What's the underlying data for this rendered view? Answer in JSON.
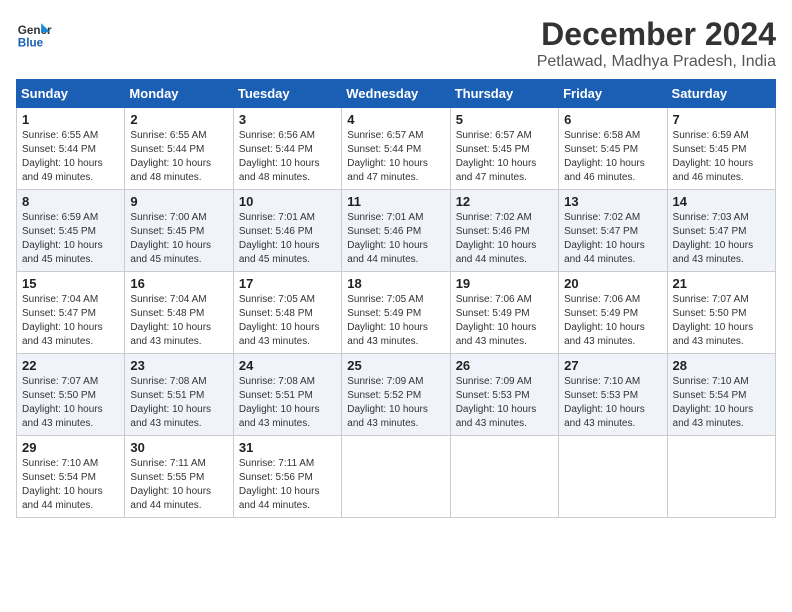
{
  "header": {
    "logo_line1": "General",
    "logo_line2": "Blue",
    "month_year": "December 2024",
    "location": "Petlawad, Madhya Pradesh, India"
  },
  "days_of_week": [
    "Sunday",
    "Monday",
    "Tuesday",
    "Wednesday",
    "Thursday",
    "Friday",
    "Saturday"
  ],
  "weeks": [
    [
      {
        "day": "1",
        "sunrise": "6:55 AM",
        "sunset": "5:44 PM",
        "daylight": "10 hours and 49 minutes."
      },
      {
        "day": "2",
        "sunrise": "6:55 AM",
        "sunset": "5:44 PM",
        "daylight": "10 hours and 48 minutes."
      },
      {
        "day": "3",
        "sunrise": "6:56 AM",
        "sunset": "5:44 PM",
        "daylight": "10 hours and 48 minutes."
      },
      {
        "day": "4",
        "sunrise": "6:57 AM",
        "sunset": "5:44 PM",
        "daylight": "10 hours and 47 minutes."
      },
      {
        "day": "5",
        "sunrise": "6:57 AM",
        "sunset": "5:45 PM",
        "daylight": "10 hours and 47 minutes."
      },
      {
        "day": "6",
        "sunrise": "6:58 AM",
        "sunset": "5:45 PM",
        "daylight": "10 hours and 46 minutes."
      },
      {
        "day": "7",
        "sunrise": "6:59 AM",
        "sunset": "5:45 PM",
        "daylight": "10 hours and 46 minutes."
      }
    ],
    [
      {
        "day": "8",
        "sunrise": "6:59 AM",
        "sunset": "5:45 PM",
        "daylight": "10 hours and 45 minutes."
      },
      {
        "day": "9",
        "sunrise": "7:00 AM",
        "sunset": "5:45 PM",
        "daylight": "10 hours and 45 minutes."
      },
      {
        "day": "10",
        "sunrise": "7:01 AM",
        "sunset": "5:46 PM",
        "daylight": "10 hours and 45 minutes."
      },
      {
        "day": "11",
        "sunrise": "7:01 AM",
        "sunset": "5:46 PM",
        "daylight": "10 hours and 44 minutes."
      },
      {
        "day": "12",
        "sunrise": "7:02 AM",
        "sunset": "5:46 PM",
        "daylight": "10 hours and 44 minutes."
      },
      {
        "day": "13",
        "sunrise": "7:02 AM",
        "sunset": "5:47 PM",
        "daylight": "10 hours and 44 minutes."
      },
      {
        "day": "14",
        "sunrise": "7:03 AM",
        "sunset": "5:47 PM",
        "daylight": "10 hours and 43 minutes."
      }
    ],
    [
      {
        "day": "15",
        "sunrise": "7:04 AM",
        "sunset": "5:47 PM",
        "daylight": "10 hours and 43 minutes."
      },
      {
        "day": "16",
        "sunrise": "7:04 AM",
        "sunset": "5:48 PM",
        "daylight": "10 hours and 43 minutes."
      },
      {
        "day": "17",
        "sunrise": "7:05 AM",
        "sunset": "5:48 PM",
        "daylight": "10 hours and 43 minutes."
      },
      {
        "day": "18",
        "sunrise": "7:05 AM",
        "sunset": "5:49 PM",
        "daylight": "10 hours and 43 minutes."
      },
      {
        "day": "19",
        "sunrise": "7:06 AM",
        "sunset": "5:49 PM",
        "daylight": "10 hours and 43 minutes."
      },
      {
        "day": "20",
        "sunrise": "7:06 AM",
        "sunset": "5:49 PM",
        "daylight": "10 hours and 43 minutes."
      },
      {
        "day": "21",
        "sunrise": "7:07 AM",
        "sunset": "5:50 PM",
        "daylight": "10 hours and 43 minutes."
      }
    ],
    [
      {
        "day": "22",
        "sunrise": "7:07 AM",
        "sunset": "5:50 PM",
        "daylight": "10 hours and 43 minutes."
      },
      {
        "day": "23",
        "sunrise": "7:08 AM",
        "sunset": "5:51 PM",
        "daylight": "10 hours and 43 minutes."
      },
      {
        "day": "24",
        "sunrise": "7:08 AM",
        "sunset": "5:51 PM",
        "daylight": "10 hours and 43 minutes."
      },
      {
        "day": "25",
        "sunrise": "7:09 AM",
        "sunset": "5:52 PM",
        "daylight": "10 hours and 43 minutes."
      },
      {
        "day": "26",
        "sunrise": "7:09 AM",
        "sunset": "5:53 PM",
        "daylight": "10 hours and 43 minutes."
      },
      {
        "day": "27",
        "sunrise": "7:10 AM",
        "sunset": "5:53 PM",
        "daylight": "10 hours and 43 minutes."
      },
      {
        "day": "28",
        "sunrise": "7:10 AM",
        "sunset": "5:54 PM",
        "daylight": "10 hours and 43 minutes."
      }
    ],
    [
      {
        "day": "29",
        "sunrise": "7:10 AM",
        "sunset": "5:54 PM",
        "daylight": "10 hours and 44 minutes."
      },
      {
        "day": "30",
        "sunrise": "7:11 AM",
        "sunset": "5:55 PM",
        "daylight": "10 hours and 44 minutes."
      },
      {
        "day": "31",
        "sunrise": "7:11 AM",
        "sunset": "5:56 PM",
        "daylight": "10 hours and 44 minutes."
      },
      null,
      null,
      null,
      null
    ]
  ],
  "labels": {
    "sunrise": "Sunrise:",
    "sunset": "Sunset:",
    "daylight": "Daylight:"
  }
}
